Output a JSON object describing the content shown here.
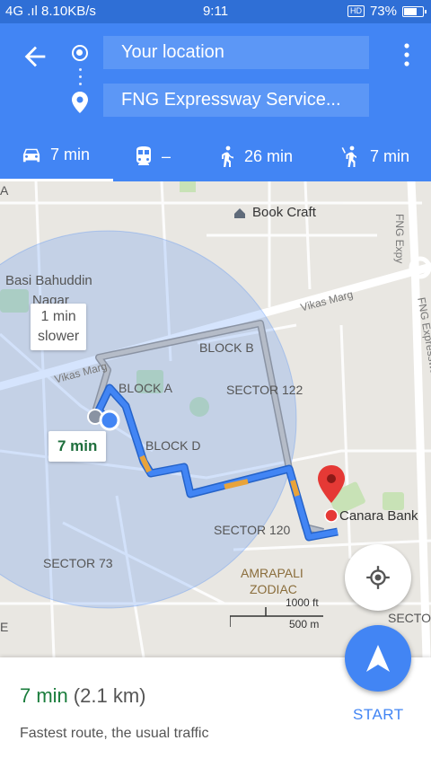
{
  "status_bar": {
    "network": "4G .ıl 8.10KB/s",
    "time": "9:11",
    "hd": "HD",
    "battery_percent": "73%",
    "battery_level": 0.73
  },
  "search": {
    "origin": "Your location",
    "destination": "FNG Expressway Service..."
  },
  "modes": [
    {
      "icon": "car-icon",
      "label": "7 min",
      "selected": true
    },
    {
      "icon": "train-icon",
      "label": "–",
      "selected": false
    },
    {
      "icon": "walk-icon",
      "label": "26 min",
      "selected": false
    },
    {
      "icon": "ride-hail-icon",
      "label": "7 min",
      "selected": false
    }
  ],
  "map": {
    "labels": {
      "place_top_left": "A",
      "book_craft": "Book Craft",
      "fng_expy": "FNG Expy",
      "fng_expressway": "FNG Expresswa",
      "basi_bahuddin": "Basi Bahuddin",
      "nagar": "Nagar",
      "vikas_marg_right": "Vikas Marg",
      "vikas_marg_left": "Vikas Marg",
      "block_b": "BLOCK B",
      "block_a": "BLOCK A",
      "sector_122": "SECTOR 122",
      "block_d": "BLOCK D",
      "canara_bank": "Canara Bank",
      "sector_120": "SECTOR 120",
      "sector_73": "SECTOR 73",
      "amrapali": "AMRAPALI",
      "zodiac": "ZODIAC",
      "secto": "SECTO",
      "edge_e": "E"
    },
    "alt_route_tag": {
      "line1": "1 min",
      "line2": "slower"
    },
    "route_tag": "7 min",
    "scale": {
      "feet": "1000 ft",
      "meters": "500 m"
    }
  },
  "route_summary": {
    "time": "7 min",
    "distance": "(2.1 km)",
    "description": "Fastest route, the usual traffic"
  },
  "start_label": "START",
  "colors": {
    "header": "#4285f4",
    "route": "#4285f4",
    "alt_route": "#9aa4b4",
    "traffic": "#e8a33a",
    "eta_green": "#1a7d3c"
  }
}
